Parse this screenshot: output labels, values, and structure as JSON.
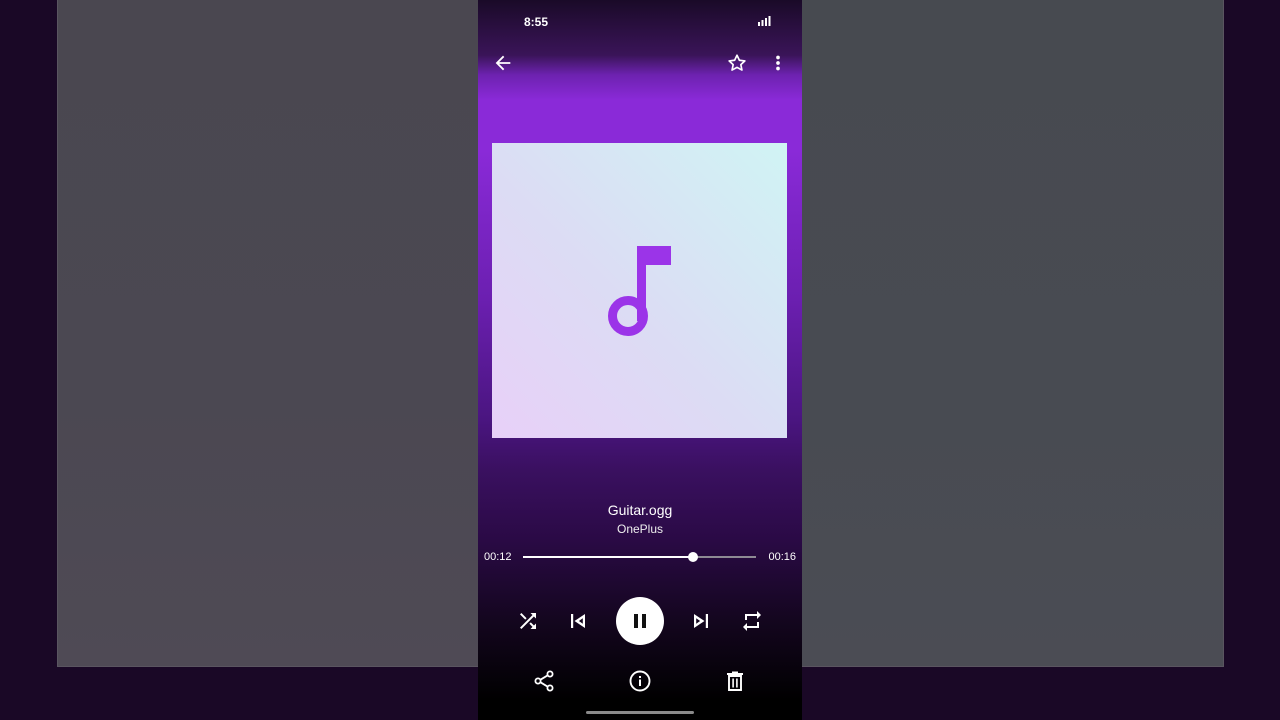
{
  "status_bar": {
    "time": "8:55",
    "signal_icon": "cell-signal-icon"
  },
  "toolbar": {
    "back_icon": "arrow-back-icon",
    "favorite_icon": "star-outline-icon",
    "menu_icon": "more-vert-icon"
  },
  "album": {
    "placeholder_icon": "music-note-icon"
  },
  "track": {
    "title": "Guitar.ogg",
    "artist": "OnePlus"
  },
  "progress": {
    "elapsed": "00:12",
    "total": "00:16",
    "fraction": 0.73
  },
  "controls": {
    "shuffle_icon": "shuffle-icon",
    "previous_icon": "skip-previous-icon",
    "play_state": "playing",
    "play_pause_icon": "pause-icon",
    "next_icon": "skip-next-icon",
    "repeat_icon": "repeat-icon"
  },
  "actions": {
    "share_icon": "share-icon",
    "info_icon": "info-icon",
    "delete_icon": "delete-icon"
  },
  "colors": {
    "accent": "#8a2ad8",
    "note": "#9b34e8"
  }
}
